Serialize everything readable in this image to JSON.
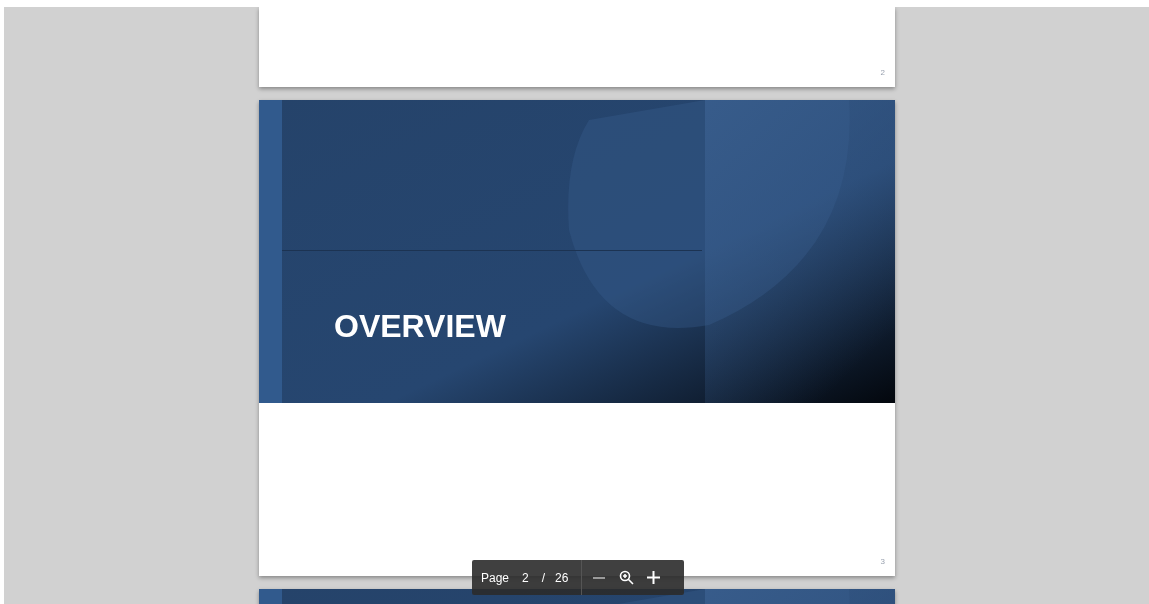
{
  "pages": [
    {
      "page_number": "2"
    },
    {
      "page_number": "3",
      "slide_title": "OVERVIEW"
    },
    {
      "kind": "slide"
    }
  ],
  "toolbar": {
    "page_label": "Page",
    "current_page": "2",
    "separator": "/",
    "total_pages": "26"
  }
}
